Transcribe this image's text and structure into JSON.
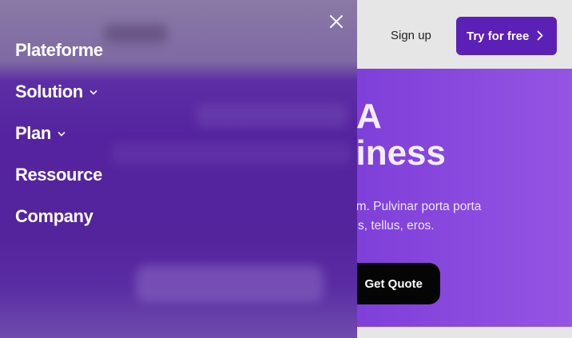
{
  "header": {
    "signup_label": "Sign up",
    "try_label": "Try for free",
    "try_icon": "chevron-right-icon"
  },
  "hero": {
    "title_line1": "A",
    "title_line2": "siness",
    "text_line1": "um. Pulvinar porta porta",
    "text_line2": "s, tellus, eros.",
    "quote_label": "Get Quote"
  },
  "nav": {
    "close_icon": "close-icon",
    "items": [
      {
        "label": "Plateforme",
        "has_dropdown": false
      },
      {
        "label": "Solution",
        "has_dropdown": true
      },
      {
        "label": "Plan",
        "has_dropdown": true
      },
      {
        "label": "Ressource",
        "has_dropdown": false
      },
      {
        "label": "Company",
        "has_dropdown": false
      }
    ]
  },
  "colors": {
    "accent": "#5b21b6",
    "hero_bg": "#7d3ed9",
    "overlay_bg": "#55239f",
    "quote_btn": "#050505"
  }
}
